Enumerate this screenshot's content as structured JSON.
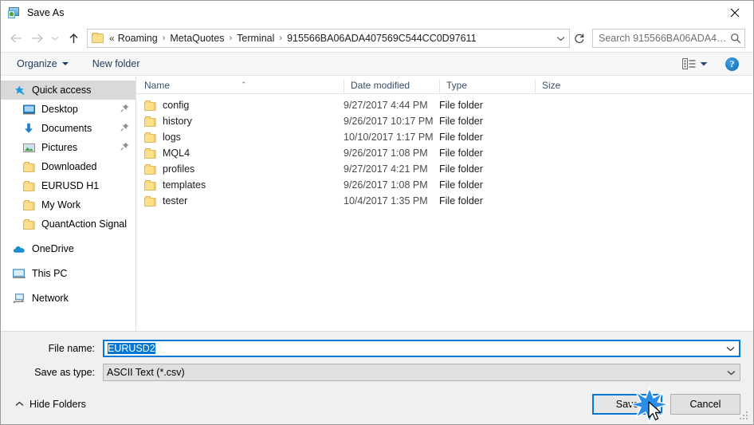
{
  "window": {
    "title": "Save As",
    "app_icon": "save-as-icon",
    "close_label": "✕"
  },
  "nav": {
    "back_icon": "arrow-left-icon",
    "forward_icon": "arrow-right-icon",
    "recent_icon": "chevron-down-icon",
    "up_icon": "arrow-up-icon",
    "breadcrumb_overflow": "«",
    "breadcrumbs": [
      "Roaming",
      "MetaQuotes",
      "Terminal",
      "915566BA06ADA407569C544CC0D97611"
    ],
    "separator": "›",
    "dropdown_icon": "chevron-down-icon",
    "refresh_icon": "refresh-icon"
  },
  "search": {
    "placeholder": "Search 915566BA06ADA40756...",
    "icon": "search-icon"
  },
  "toolbar": {
    "organize_label": "Organize",
    "new_folder_label": "New folder",
    "view_icon": "view-layout-icon",
    "view_dropdown_icon": "chevron-down-icon",
    "help_icon": "help-icon",
    "help_label": "?"
  },
  "sidebar": {
    "items": [
      {
        "label": "Quick access",
        "icon": "star-pin-icon",
        "selected": true,
        "indent": false,
        "pinned": false
      },
      {
        "label": "Desktop",
        "icon": "monitor-icon",
        "selected": false,
        "indent": true,
        "pinned": true
      },
      {
        "label": "Documents",
        "icon": "download-arrow-icon",
        "selected": false,
        "indent": true,
        "pinned": true
      },
      {
        "label": "Pictures",
        "icon": "picture-icon",
        "selected": false,
        "indent": true,
        "pinned": true
      },
      {
        "label": "Downloaded",
        "icon": "folder-icon",
        "selected": false,
        "indent": true,
        "pinned": false
      },
      {
        "label": "EURUSD H1",
        "icon": "folder-icon",
        "selected": false,
        "indent": true,
        "pinned": false
      },
      {
        "label": "My Work",
        "icon": "folder-icon",
        "selected": false,
        "indent": true,
        "pinned": false
      },
      {
        "label": "QuantAction Signal",
        "icon": "folder-icon",
        "selected": false,
        "indent": true,
        "pinned": false
      }
    ],
    "groups": [
      {
        "label": "OneDrive",
        "icon": "onedrive-cloud-icon"
      },
      {
        "label": "This PC",
        "icon": "computer-icon"
      },
      {
        "label": "Network",
        "icon": "network-icon"
      }
    ]
  },
  "filelist": {
    "columns": [
      "Name",
      "Date modified",
      "Type",
      "Size"
    ],
    "sort_indicator": "⌃",
    "rows": [
      {
        "name": "config",
        "date": "9/27/2017 4:44 PM",
        "type": "File folder",
        "size": ""
      },
      {
        "name": "history",
        "date": "9/26/2017 10:17 PM",
        "type": "File folder",
        "size": ""
      },
      {
        "name": "logs",
        "date": "10/10/2017 1:17 PM",
        "type": "File folder",
        "size": ""
      },
      {
        "name": "MQL4",
        "date": "9/26/2017 1:08 PM",
        "type": "File folder",
        "size": ""
      },
      {
        "name": "profiles",
        "date": "9/27/2017 4:21 PM",
        "type": "File folder",
        "size": ""
      },
      {
        "name": "templates",
        "date": "9/26/2017 1:08 PM",
        "type": "File folder",
        "size": ""
      },
      {
        "name": "tester",
        "date": "10/4/2017 1:35 PM",
        "type": "File folder",
        "size": ""
      }
    ]
  },
  "form": {
    "filename_label": "File name:",
    "filename_value": "EURUSD2",
    "filetype_label": "Save as type:",
    "filetype_value": "ASCII Text (*.csv)"
  },
  "footer": {
    "hide_folders_label": "Hide Folders",
    "hide_folders_icon": "chevron-up-icon",
    "save_label": "Save",
    "cancel_label": "Cancel"
  },
  "colors": {
    "accent": "#0078d7",
    "folder": "#fcdf8a",
    "selection": "#d9d9d9",
    "header_text": "#38506b"
  }
}
